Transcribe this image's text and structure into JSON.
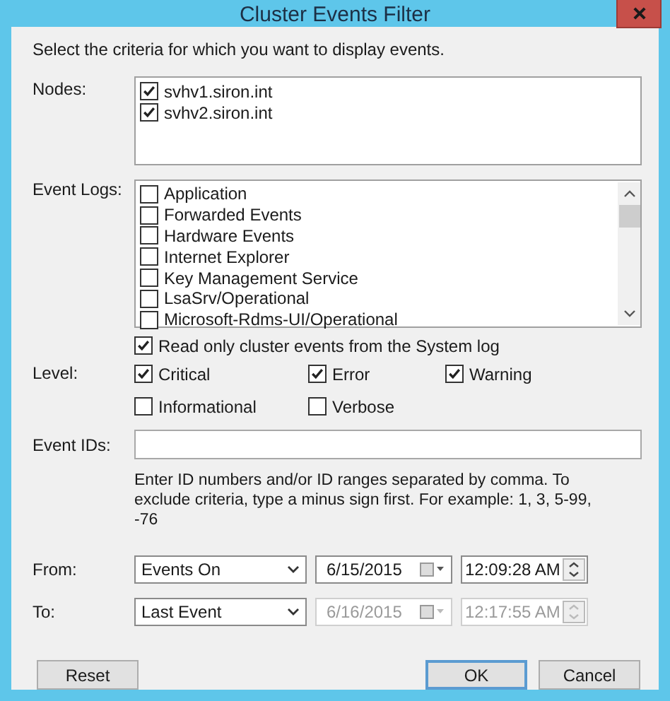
{
  "window": {
    "title": "Cluster Events Filter"
  },
  "intro": "Select the criteria for which you want to display events.",
  "nodes": {
    "label": "Nodes:",
    "items": [
      {
        "label": "svhv1.siron.int",
        "checked": true
      },
      {
        "label": "svhv2.siron.int",
        "checked": true
      }
    ]
  },
  "event_logs": {
    "label": "Event Logs:",
    "items": [
      {
        "label": "Application",
        "checked": false
      },
      {
        "label": "Forwarded Events",
        "checked": false
      },
      {
        "label": "Hardware Events",
        "checked": false
      },
      {
        "label": "Internet Explorer",
        "checked": false
      },
      {
        "label": "Key Management Service",
        "checked": false
      },
      {
        "label": "LsaSrv/Operational",
        "checked": false
      },
      {
        "label": "Microsoft-Rdms-UI/Operational",
        "checked": false
      }
    ]
  },
  "read_only": {
    "label": "Read only cluster events from the System log",
    "checked": true
  },
  "level": {
    "label": "Level:",
    "options": [
      {
        "label": "Critical",
        "checked": true
      },
      {
        "label": "Error",
        "checked": true
      },
      {
        "label": "Warning",
        "checked": true
      },
      {
        "label": "Informational",
        "checked": false
      },
      {
        "label": "Verbose",
        "checked": false
      }
    ]
  },
  "event_ids": {
    "label": "Event IDs:",
    "hint": "Enter ID numbers and/or ID ranges separated by comma. To exclude criteria, type a minus sign first. For example: 1, 3, 5-99, -76"
  },
  "range": [
    {
      "label": "From:",
      "mode": "Events On",
      "date": "6/15/2015",
      "time": "12:09:28 AM",
      "disabled": false
    },
    {
      "label": "To:",
      "mode": "Last Event",
      "date": "6/16/2015",
      "time": "12:17:55 AM",
      "disabled": true
    }
  ],
  "buttons": [
    {
      "label": "Reset",
      "kind": "normal"
    },
    {
      "label": "OK",
      "kind": "default"
    },
    {
      "label": "Cancel",
      "kind": "normal"
    }
  ]
}
